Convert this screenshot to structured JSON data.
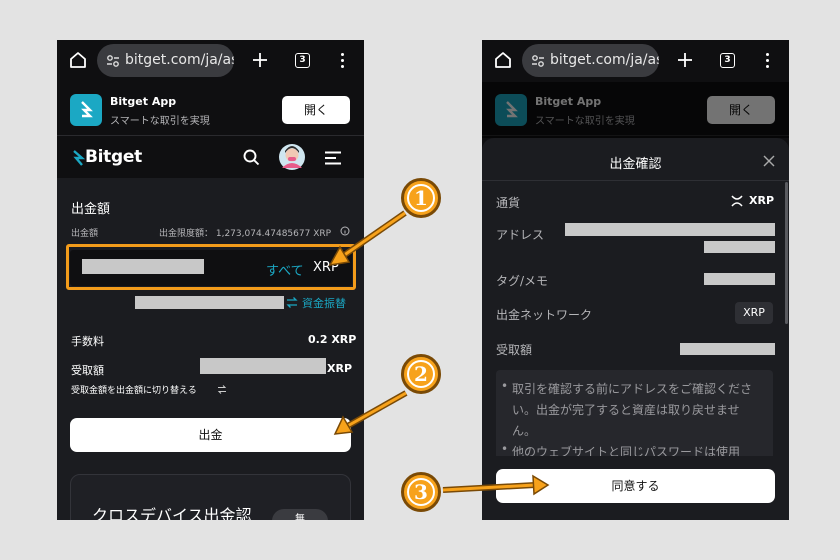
{
  "browser": {
    "url": "bitget.com/ja/ass",
    "tab_count": "3"
  },
  "app_banner": {
    "title": "Bitget App",
    "subtitle": "スマートな取引を実現",
    "open_button": "開く"
  },
  "header": {
    "logo": "Bitget"
  },
  "withdraw": {
    "section_title": "出金額",
    "amount_label": "出金額",
    "limit_text": "出金限度額： 1,273,074.47485677 XRP",
    "all_button": "すべて",
    "currency": "XRP",
    "transfer_link": "資金振替",
    "fee_label": "手数料",
    "fee_value": "0.2 XRP",
    "received_label": "受取額",
    "received_unit": "XRP",
    "switch_text": "受取金額を出金額に切り替える",
    "withdraw_button": "出金",
    "cross_device_title": "クロスデバイス出金認",
    "cross_device_badge": "無"
  },
  "confirm": {
    "title": "出金確認",
    "currency_label": "通貨",
    "currency_value": "XRP",
    "address_label": "アドレス",
    "tag_label": "タグ/メモ",
    "network_label": "出金ネットワーク",
    "network_value": "XRP",
    "received_label": "受取額",
    "notes": [
      "取引を確認する前にアドレスをご確認ください。出金が完了すると資産は取り戻せません。",
      "他のウェブサイトと同じパスワードは使用"
    ],
    "agree_button": "同意する"
  },
  "callouts": [
    "1",
    "2",
    "3"
  ],
  "colors": {
    "accent": "#1ba8c4",
    "highlight": "#f39c1b",
    "callout": "#f7a21b",
    "background": "#e3e3e3"
  }
}
